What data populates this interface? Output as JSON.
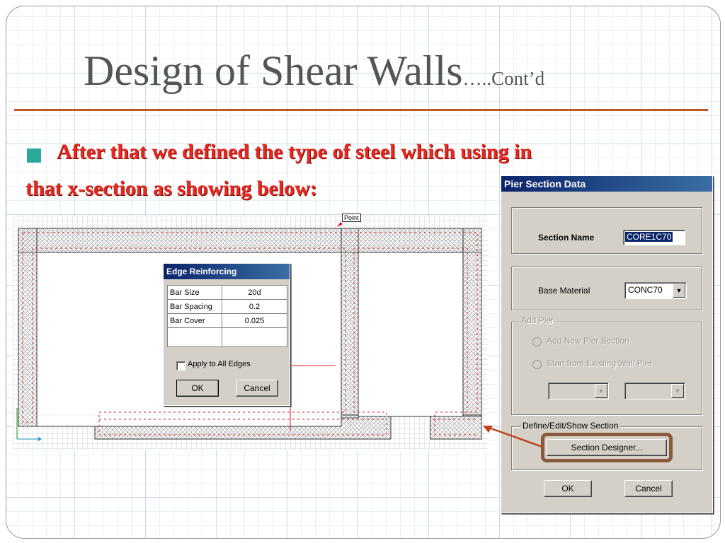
{
  "slide": {
    "title": "Design of Shear Walls",
    "title_suffix": "…..Cont’d",
    "bullet_line1": "After that we defined the type of steel which using in",
    "bullet_line2": "that x-section as showing below:",
    "accent_color": "#c0572a",
    "bullet_color": "#2aa89a",
    "text_color": "#e8271e"
  },
  "drawing": {
    "point_label": "Point"
  },
  "edge_dialog": {
    "title": "Edge Reinforcing",
    "rows": [
      {
        "label": "Bar Size",
        "value": "20d"
      },
      {
        "label": "Bar Spacing",
        "value": "0.2"
      },
      {
        "label": "Bar Cover",
        "value": "0.025"
      }
    ],
    "apply_all_label": "Apply to All Edges",
    "ok_label": "OK",
    "cancel_label": "Cancel"
  },
  "pier_dialog": {
    "title": "Pier Section Data",
    "section_name_label": "Section Name",
    "section_name_value": "CORE1C70",
    "base_material_label": "Base Material",
    "base_material_value": "CONC70",
    "add_pier_group": "Add Pier",
    "add_new_option": "Add New Pier Section",
    "start_existing_option": "Start from Existing Wall Pier",
    "define_group": "Define/Edit/Show Section",
    "section_designer_label": "Section Designer...",
    "ok_label": "OK",
    "cancel_label": "Cancel"
  }
}
